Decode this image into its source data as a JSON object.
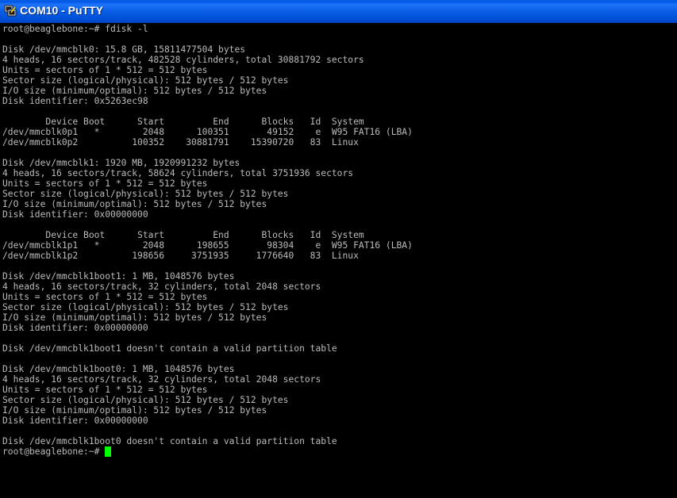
{
  "window": {
    "title": "COM10 - PuTTY",
    "icon": "putty-terminal-icon"
  },
  "colors": {
    "titlebar": "#0058e6",
    "background": "#000000",
    "text": "#bbbbbb",
    "cursor": "#00ff00"
  },
  "terminal": {
    "lines": [
      "root@beaglebone:~# fdisk -l",
      "",
      "Disk /dev/mmcblk0: 15.8 GB, 15811477504 bytes",
      "4 heads, 16 sectors/track, 482528 cylinders, total 30881792 sectors",
      "Units = sectors of 1 * 512 = 512 bytes",
      "Sector size (logical/physical): 512 bytes / 512 bytes",
      "I/O size (minimum/optimal): 512 bytes / 512 bytes",
      "Disk identifier: 0x5263ec98",
      "",
      "        Device Boot      Start         End      Blocks   Id  System",
      "/dev/mmcblk0p1   *        2048      100351       49152    e  W95 FAT16 (LBA)",
      "/dev/mmcblk0p2          100352    30881791    15390720   83  Linux",
      "",
      "Disk /dev/mmcblk1: 1920 MB, 1920991232 bytes",
      "4 heads, 16 sectors/track, 58624 cylinders, total 3751936 sectors",
      "Units = sectors of 1 * 512 = 512 bytes",
      "Sector size (logical/physical): 512 bytes / 512 bytes",
      "I/O size (minimum/optimal): 512 bytes / 512 bytes",
      "Disk identifier: 0x00000000",
      "",
      "        Device Boot      Start         End      Blocks   Id  System",
      "/dev/mmcblk1p1   *        2048      198655       98304    e  W95 FAT16 (LBA)",
      "/dev/mmcblk1p2          198656     3751935     1776640   83  Linux",
      "",
      "Disk /dev/mmcblk1boot1: 1 MB, 1048576 bytes",
      "4 heads, 16 sectors/track, 32 cylinders, total 2048 sectors",
      "Units = sectors of 1 * 512 = 512 bytes",
      "Sector size (logical/physical): 512 bytes / 512 bytes",
      "I/O size (minimum/optimal): 512 bytes / 512 bytes",
      "Disk identifier: 0x00000000",
      "",
      "Disk /dev/mmcblk1boot1 doesn't contain a valid partition table",
      "",
      "Disk /dev/mmcblk1boot0: 1 MB, 1048576 bytes",
      "4 heads, 16 sectors/track, 32 cylinders, total 2048 sectors",
      "Units = sectors of 1 * 512 = 512 bytes",
      "Sector size (logical/physical): 512 bytes / 512 bytes",
      "I/O size (minimum/optimal): 512 bytes / 512 bytes",
      "Disk identifier: 0x00000000",
      "",
      "Disk /dev/mmcblk1boot0 doesn't contain a valid partition table"
    ],
    "prompt": "root@beaglebone:~# "
  }
}
